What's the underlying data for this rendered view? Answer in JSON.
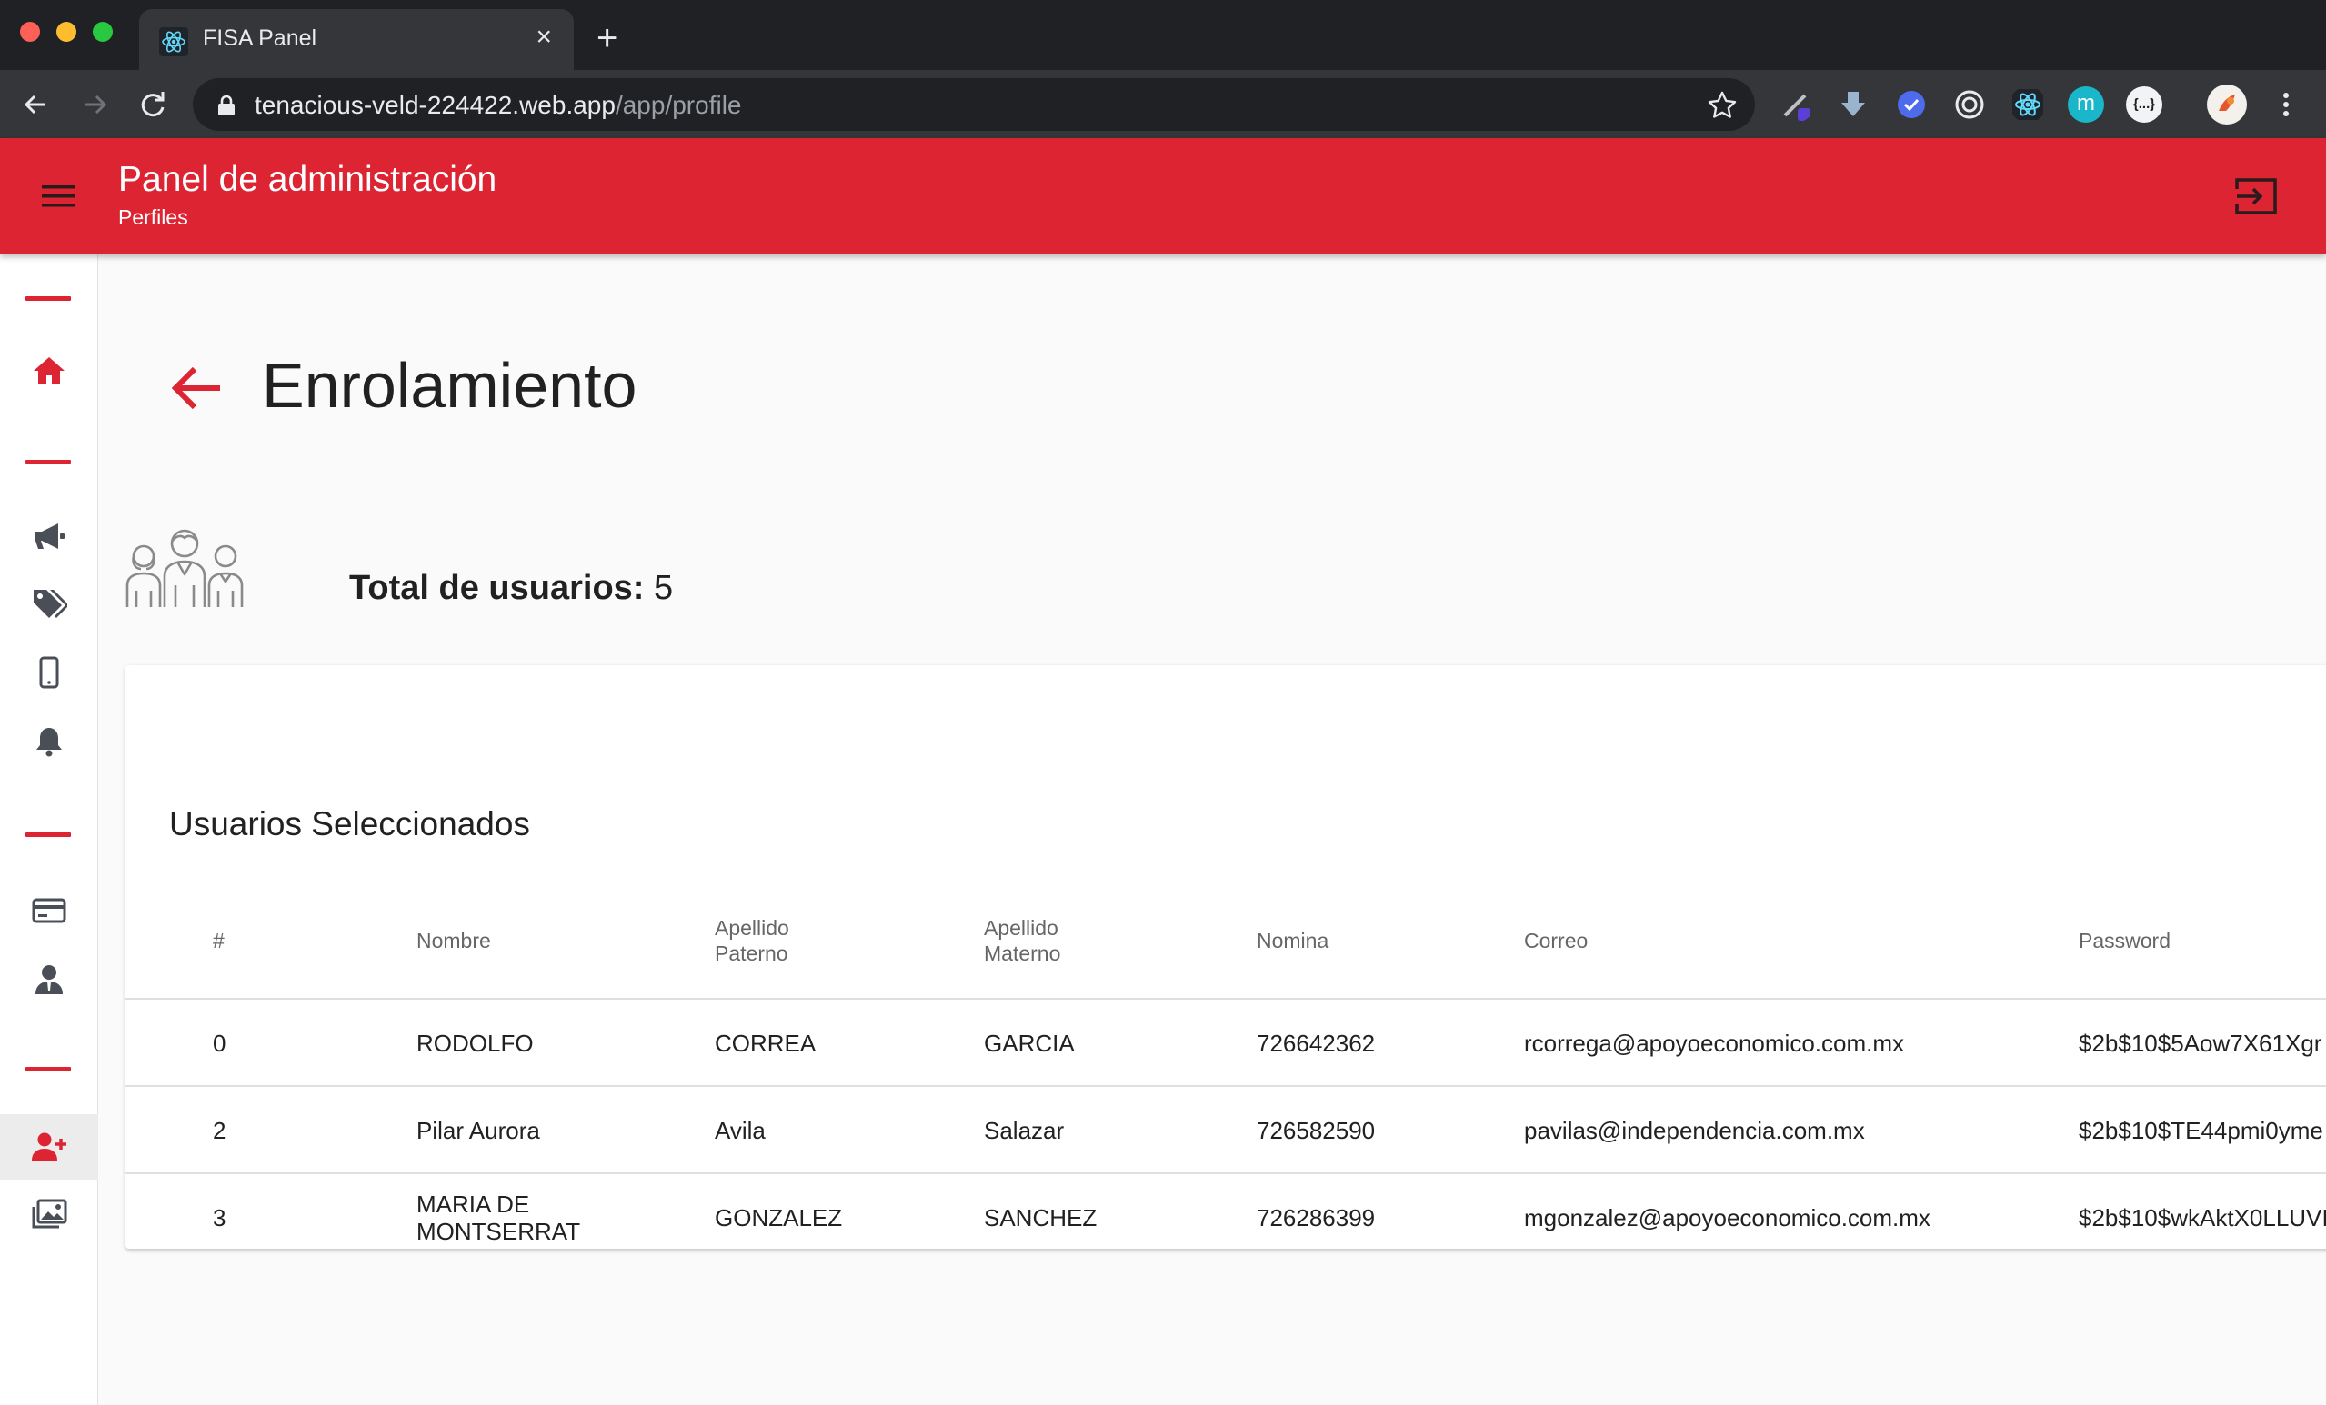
{
  "browser": {
    "tab_title": "FISA Panel",
    "url_host": "tenacious-veld-224422.web.app",
    "url_path": "/app/profile",
    "extensions": [
      "pen-extension-icon",
      "download-extension-icon",
      "check-extension-icon",
      "target-extension-icon",
      "react-devtools-icon",
      "m-extension-icon",
      "json-extension-icon"
    ],
    "ext_m_label": "m",
    "ext_json_label": "{...}"
  },
  "appbar": {
    "title": "Panel de administración",
    "subtitle": "Perfiles"
  },
  "sidebar": {
    "items": [
      "home",
      "campaigns",
      "promotions",
      "devices",
      "notifications",
      "cards",
      "agents",
      "enrollment",
      "gallery"
    ],
    "active": "enrollment"
  },
  "page": {
    "title": "Enrolamiento",
    "total_label": "Total de usuarios:",
    "total_value": "5"
  },
  "table": {
    "title": "Usuarios Seleccionados",
    "headers": [
      "#",
      "Nombre",
      "Apellido Paterno",
      "Apellido Materno",
      "Nomina",
      "Correo",
      "Password"
    ],
    "rows": [
      [
        "0",
        "RODOLFO",
        "CORREA",
        "GARCIA",
        "726642362",
        "rcorrega@apoyoeconomico.com.mx",
        "$2b$10$5Aow7X61Xgr"
      ],
      [
        "2",
        "Pilar Aurora",
        "Avila",
        "Salazar",
        "726582590",
        "pavilas@independencia.com.mx",
        "$2b$10$TE44pmi0yme"
      ],
      [
        "3",
        "MARIA DE MONTSERRAT",
        "GONZALEZ",
        "SANCHEZ",
        "726286399",
        "mgonzalez@apoyoeconomico.com.mx",
        "$2b$10$wkAktX0LLUVI"
      ]
    ]
  },
  "colors": {
    "brand": "#dc2433",
    "chrome_dark": "#202124",
    "chrome_toolbar": "#35363a"
  }
}
